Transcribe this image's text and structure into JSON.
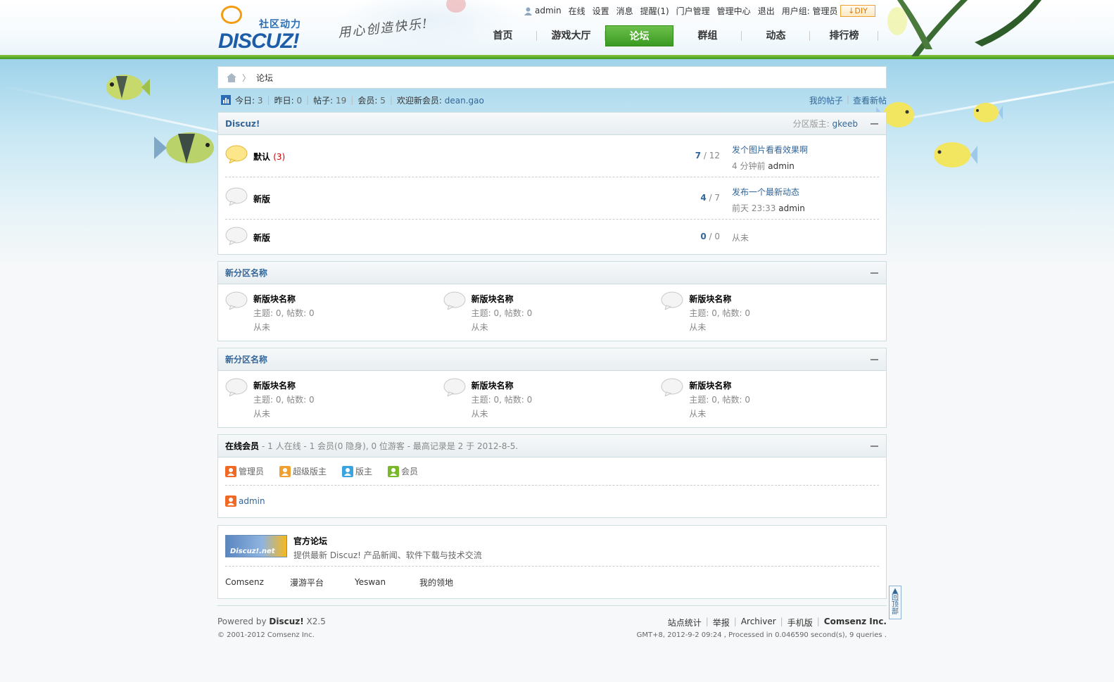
{
  "brand": {
    "logo_sub": "社区动力",
    "logo_main": "DISCUZ!",
    "slogan": "用心创造快乐!"
  },
  "user_links": {
    "username": "admin",
    "online": "在线",
    "settings": "设置",
    "messages": "消息",
    "reminders": "提醒(1)",
    "portal_admin": "门户管理",
    "admin_center": "管理中心",
    "logout": "退出",
    "user_group": "用户组: 管理员",
    "diy": "DIY"
  },
  "nav": [
    {
      "label": "首页",
      "active": false
    },
    {
      "label": "游戏大厅",
      "active": false
    },
    {
      "label": "论坛",
      "active": true
    },
    {
      "label": "群组",
      "active": false
    },
    {
      "label": "动态",
      "active": false
    },
    {
      "label": "排行榜",
      "active": false
    }
  ],
  "breadcrumb": {
    "sep": "〉",
    "current": "论坛"
  },
  "stats": {
    "today_label": "今日:",
    "today": "3",
    "yesterday_label": "昨日:",
    "yesterday": "0",
    "posts_label": "帖子:",
    "posts": "19",
    "members_label": "会员:",
    "members": "5",
    "newest_label": "欢迎新会员:",
    "newest": "dean.gao",
    "my_posts": "我的帖子",
    "new_posts": "查看新帖"
  },
  "category_discuz": {
    "title": "Discuz!",
    "moderator_label": "分区版主:",
    "moderator": "gkeeb",
    "forums": [
      {
        "name": "默认",
        "today": "(3)",
        "threads": "7",
        "posts": "12",
        "last_title": "发个图片看看效果啊",
        "last_time": "4 分钟前",
        "last_author": "admin"
      },
      {
        "name": "新版",
        "today": "",
        "threads": "4",
        "posts": "7",
        "last_title": "发布一个最新动态",
        "last_time": "前天 23:33",
        "last_author": "admin"
      },
      {
        "name": "新版",
        "today": "",
        "threads": "0",
        "posts": "0",
        "last_title": "",
        "last_time": "从未",
        "last_author": ""
      }
    ]
  },
  "category_new_1": {
    "title": "新分区名称",
    "forums": [
      {
        "name": "新版块名称",
        "stats": "主题: 0, 帖数: 0",
        "last": "从未"
      },
      {
        "name": "新版块名称",
        "stats": "主题: 0, 帖数: 0",
        "last": "从未"
      },
      {
        "name": "新版块名称",
        "stats": "主题: 0, 帖数: 0",
        "last": "从未"
      }
    ]
  },
  "category_new_2": {
    "title": "新分区名称",
    "forums": [
      {
        "name": "新版块名称",
        "stats": "主题: 0, 帖数: 0",
        "last": "从未"
      },
      {
        "name": "新版块名称",
        "stats": "主题: 0, 帖数: 0",
        "last": "从未"
      },
      {
        "name": "新版块名称",
        "stats": "主题: 0, 帖数: 0",
        "last": "从未"
      }
    ]
  },
  "online": {
    "title": "在线会员",
    "summary": "- 1 人在线 - 1 会员(0 隐身), 0 位游客 - 最高记录是 2 于 2012-8-5.",
    "legend": [
      {
        "label": "管理员",
        "color": "#f06a25"
      },
      {
        "label": "超级版主",
        "color": "#f0a030"
      },
      {
        "label": "版主",
        "color": "#3aa4e0"
      },
      {
        "label": "会员",
        "color": "#78b82a"
      }
    ],
    "users": [
      "admin"
    ]
  },
  "friend_links": {
    "official_logo_text": "Discuz!.net",
    "official_name": "官方论坛",
    "official_desc": "提供最新 Discuz! 产品新闻、软件下载与技术交流",
    "links": [
      "Comsenz",
      "漫游平台",
      "Yeswan",
      "我的领地"
    ]
  },
  "footer": {
    "powered_prefix": "Powered by ",
    "powered_brand": "Discuz!",
    "powered_version": " X2.5",
    "copyright": "© 2001-2012 Comsenz Inc.",
    "links": [
      "站点统计",
      "举报",
      "Archiver",
      "手机版",
      "Comsenz Inc."
    ],
    "process": "GMT+8, 2012-9-2 09:24 , Processed in 0.046590 second(s), 9 queries ."
  },
  "back_top": "回顶部",
  "colors": {
    "nav_active": "#4aaa2c",
    "link": "#336699",
    "header_line": "#5cb030"
  }
}
